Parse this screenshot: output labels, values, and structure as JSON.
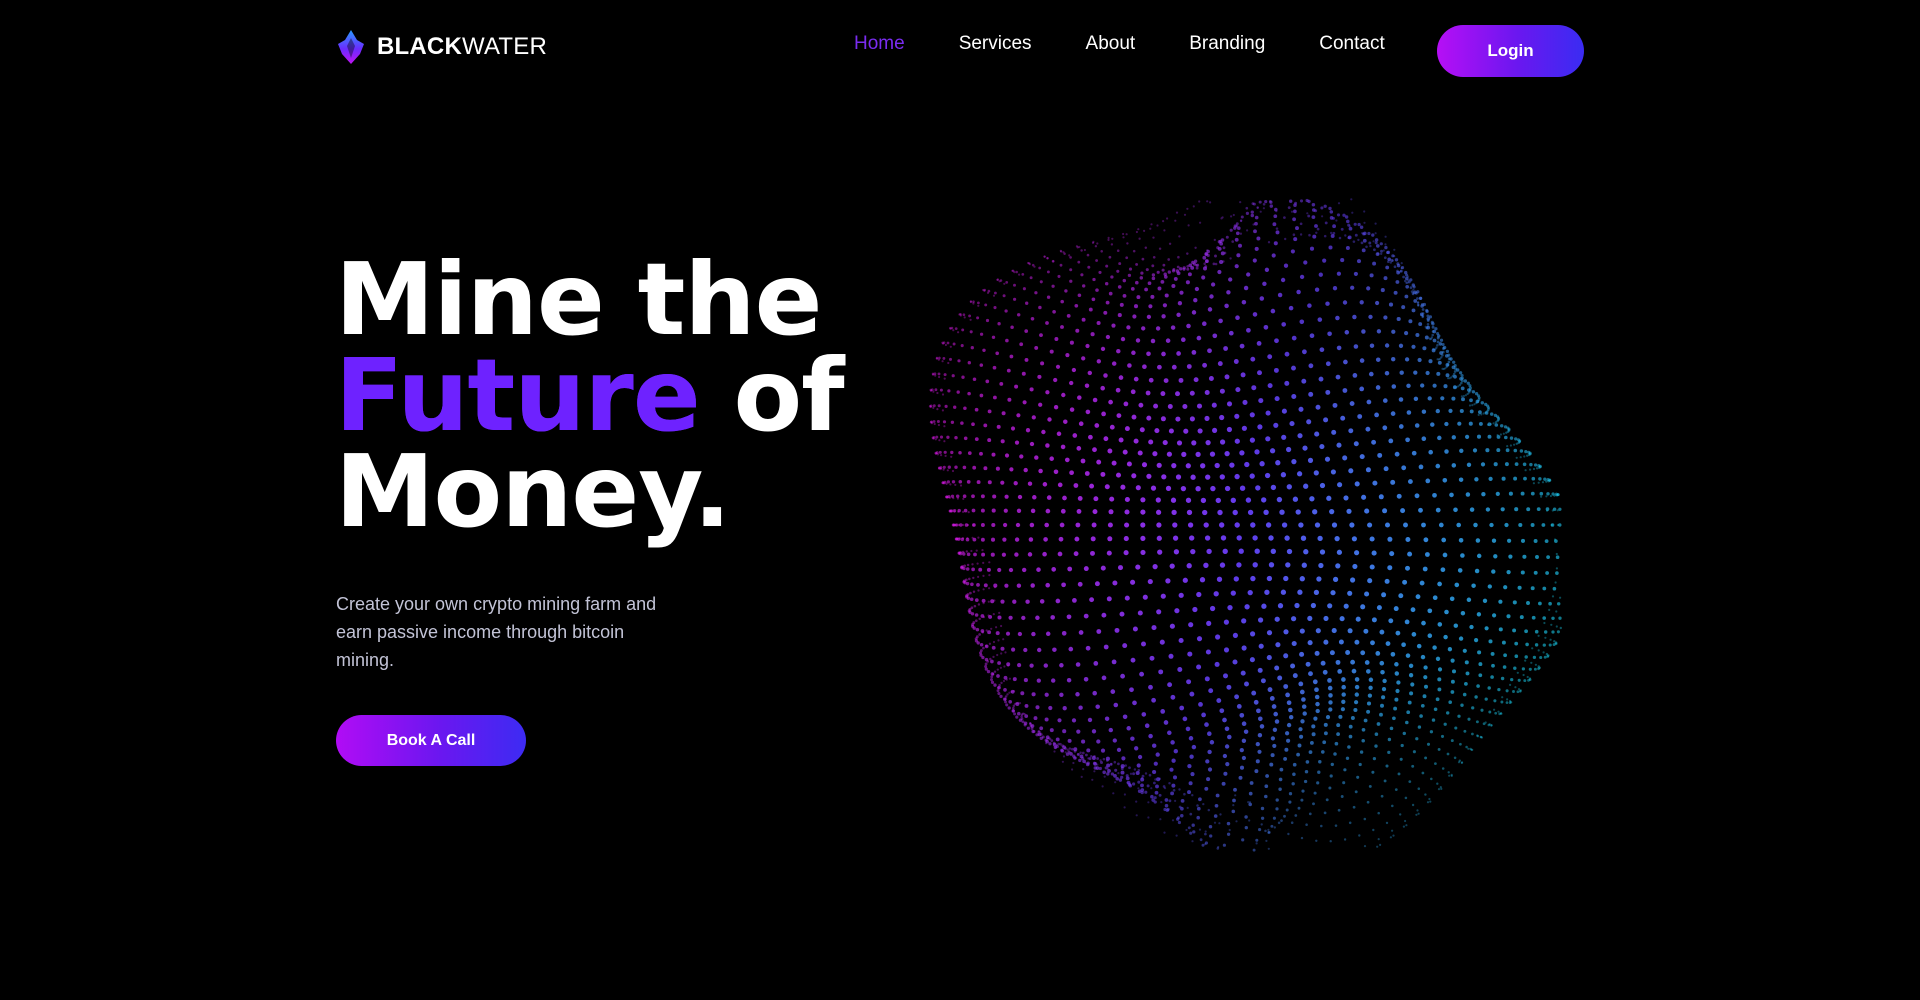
{
  "brand": {
    "name_bold": "BLACK",
    "name_light": "WATER",
    "logo_icon": "flame-diamond-icon"
  },
  "nav": {
    "items": [
      {
        "label": "Home",
        "active": true
      },
      {
        "label": "Services",
        "active": false
      },
      {
        "label": "About",
        "active": false
      },
      {
        "label": "Branding",
        "active": false
      },
      {
        "label": "Contact",
        "active": false
      }
    ],
    "login_label": "Login"
  },
  "hero": {
    "title_line1": "Mine the",
    "title_accent": "Future",
    "title_line2_rest": " of",
    "title_line3": "Money.",
    "subtitle": "Create your own crypto mining farm and earn passive income through bitcoin mining.",
    "cta_label": "Book A Call"
  },
  "colors": {
    "background": "#000000",
    "accent": "#6e22ff",
    "active_nav": "#7a2cf0",
    "gradient_start": "#b60ff5",
    "gradient_end": "#3a2cf2",
    "orb_magenta": "#e21bf0",
    "orb_cyan": "#1ad6f5"
  }
}
